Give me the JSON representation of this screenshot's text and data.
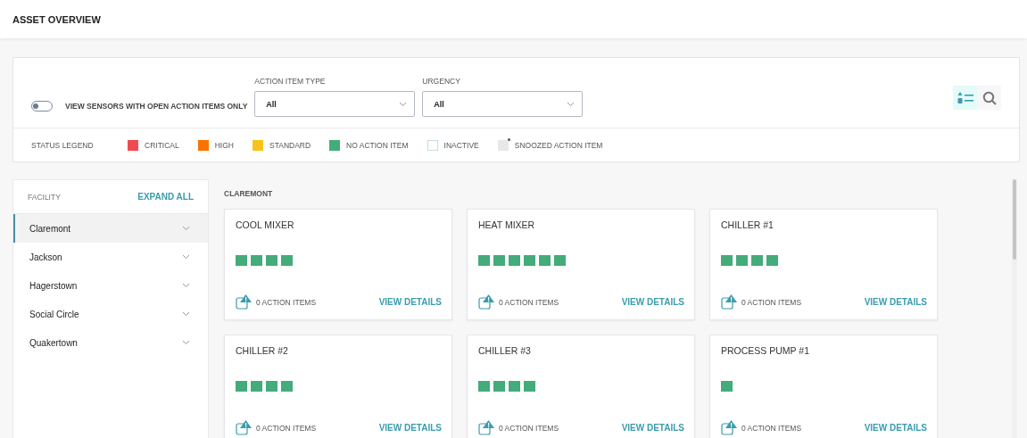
{
  "header": {
    "title": "ASSET OVERVIEW"
  },
  "filters": {
    "toggle": {
      "label": "VIEW SENSORS WITH OPEN ACTION ITEMS ONLY",
      "on": false
    },
    "dropdowns": [
      {
        "label": "ACTION ITEM TYPE",
        "value": "All"
      },
      {
        "label": "URGENCY",
        "value": "All"
      }
    ],
    "view_buttons": [
      {
        "kind": "list",
        "selected": true
      },
      {
        "kind": "search",
        "selected": false
      }
    ],
    "legend_title": "STATUS LEGEND",
    "legend": [
      {
        "label": "CRITICAL",
        "kind": "solid",
        "color": "#ef4b50"
      },
      {
        "label": "HIGH",
        "kind": "solid",
        "color": "#fb7200"
      },
      {
        "label": "STANDARD",
        "kind": "solid",
        "color": "#f7c31b"
      },
      {
        "label": "NO ACTION ITEM",
        "kind": "solid",
        "color": "#43ac7a"
      },
      {
        "label": "INACTIVE",
        "kind": "outline",
        "color": "#c8dbe6"
      },
      {
        "label": "SNOOZED ACTION ITEM",
        "kind": "snoozed",
        "color": "#e8e8ea"
      }
    ]
  },
  "sidebar": {
    "title": "FACILITY",
    "action": "EXPAND ALL",
    "items": [
      {
        "label": "Claremont",
        "selected": true
      },
      {
        "label": "Jackson",
        "selected": false
      },
      {
        "label": "Hagerstown",
        "selected": false
      },
      {
        "label": "Social Circle",
        "selected": false
      },
      {
        "label": "Quakertown",
        "selected": false
      }
    ]
  },
  "content": {
    "title": "CLAREMONT",
    "assets": [
      {
        "name": "COOL MIXER",
        "sensors": [
          {
            "color": "#43ac7a"
          },
          {
            "color": "#43ac7a"
          },
          {
            "color": "#43ac7a"
          },
          {
            "color": "#43ac7a"
          }
        ],
        "action_items": "0 ACTION ITEMS",
        "link": "VIEW DETAILS"
      },
      {
        "name": "HEAT MIXER",
        "sensors": [
          {
            "color": "#43ac7a"
          },
          {
            "color": "#43ac7a"
          },
          {
            "color": "#43ac7a"
          },
          {
            "color": "#43ac7a"
          },
          {
            "color": "#43ac7a"
          },
          {
            "color": "#43ac7a"
          }
        ],
        "action_items": "0 ACTION ITEMS",
        "link": "VIEW DETAILS"
      },
      {
        "name": "CHILLER #1",
        "sensors": [
          {
            "color": "#43ac7a"
          },
          {
            "color": "#43ac7a"
          },
          {
            "color": "#43ac7a"
          },
          {
            "color": "#43ac7a"
          }
        ],
        "action_items": "0 ACTION ITEMS",
        "link": "VIEW DETAILS"
      },
      {
        "name": "CHILLER #2",
        "sensors": [
          {
            "color": "#43ac7a"
          },
          {
            "color": "#43ac7a"
          },
          {
            "color": "#43ac7a"
          },
          {
            "color": "#43ac7a"
          }
        ],
        "action_items": "0 ACTION ITEMS",
        "link": "VIEW DETAILS"
      },
      {
        "name": "CHILLER #3",
        "sensors": [
          {
            "color": "#43ac7a"
          },
          {
            "color": "#43ac7a"
          },
          {
            "color": "#43ac7a"
          },
          {
            "color": "#43ac7a"
          }
        ],
        "action_items": "0 ACTION ITEMS",
        "link": "VIEW DETAILS"
      },
      {
        "name": "PROCESS PUMP #1",
        "sensors": [
          {
            "color": "#43ac7a"
          }
        ],
        "action_items": "0 ACTION ITEMS",
        "link": "VIEW DETAILS"
      }
    ]
  }
}
